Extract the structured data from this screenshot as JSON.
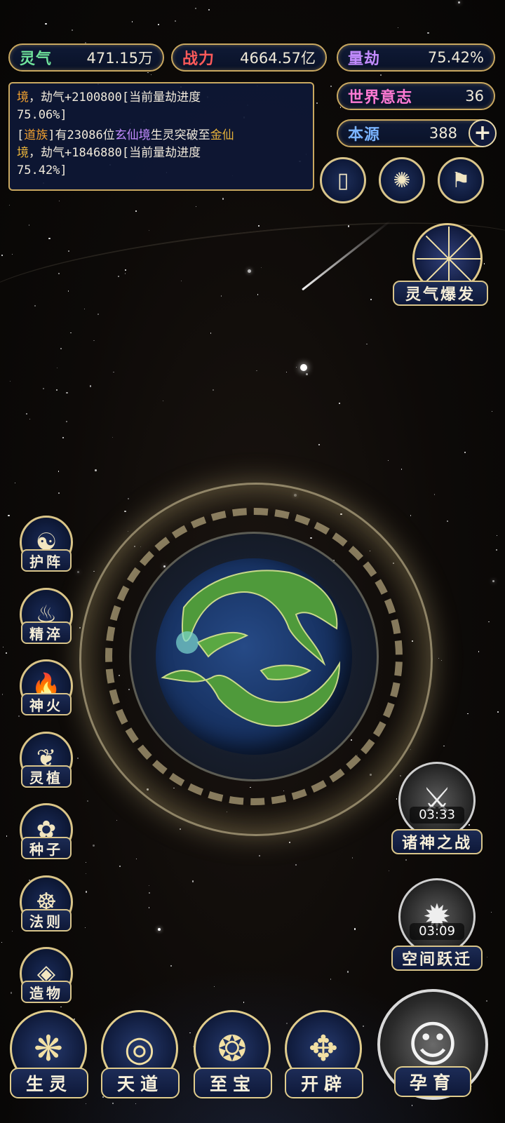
{
  "stats": {
    "lingqi": {
      "label": "灵气",
      "value": "471.15万"
    },
    "zhanli": {
      "label": "战力",
      "value": "4664.57亿"
    },
    "liangjie": {
      "label": "量劫",
      "value": "75.42%"
    },
    "world_will": {
      "label": "世界意志",
      "value": "36"
    },
    "origin": {
      "label": "本源",
      "value": "388",
      "plus": "+"
    }
  },
  "log": {
    "line1_a": "境",
    "line1_b": "，劫气+2100800[当前量劫进度",
    "line1_c": "75.06%]",
    "line2_open": "[",
    "line2_tag": "道族",
    "line2_close": "]",
    "line2_text": "有23086位",
    "line2_realm1": "玄仙境",
    "line2_mid": "生灵突破至",
    "line2_realm2": "金仙",
    "line2_realm2b": "境",
    "line2_tail": "，劫气+1846880[当前量劫进度",
    "line2_pct": "75.42%]"
  },
  "top_buttons": [
    {
      "name": "card-icon",
      "glyph": "▯"
    },
    {
      "name": "vortex-icon",
      "glyph": "✺"
    },
    {
      "name": "flag-icon",
      "glyph": "⚑"
    }
  ],
  "burst": {
    "label": "灵气爆发"
  },
  "side_menu": [
    {
      "label": "护阵",
      "glyph": "☯",
      "icon": "yin-yang-icon"
    },
    {
      "label": "精淬",
      "glyph": "♨",
      "icon": "lotus-flame-icon"
    },
    {
      "label": "神火",
      "glyph": "🔥",
      "icon": "flame-icon"
    },
    {
      "label": "灵植",
      "glyph": "❦",
      "icon": "plant-icon"
    },
    {
      "label": "种子",
      "glyph": "✿",
      "icon": "seed-flower-icon"
    },
    {
      "label": "法则",
      "glyph": "☸",
      "icon": "law-icon"
    },
    {
      "label": "造物",
      "glyph": "◈",
      "icon": "creation-icon"
    }
  ],
  "events": [
    {
      "label": "诸神之战",
      "timer": "03:33",
      "glyph": "⚔",
      "icon": "sword-icon"
    },
    {
      "label": "空间跃迁",
      "timer": "03:09",
      "glyph": "✹",
      "icon": "portal-icon"
    }
  ],
  "bottom_nav": [
    {
      "label": "生灵",
      "glyph": "❋",
      "icon": "phoenix-icon"
    },
    {
      "label": "天道",
      "glyph": "◎",
      "icon": "heaven-swirl-icon"
    },
    {
      "label": "至宝",
      "glyph": "❂",
      "icon": "treasure-icon"
    },
    {
      "label": "开辟",
      "glyph": "✥",
      "icon": "creation-flame-icon"
    }
  ],
  "nurture": {
    "label": "孕育",
    "glyph": "☺",
    "icon": "nurture-figure-icon"
  }
}
